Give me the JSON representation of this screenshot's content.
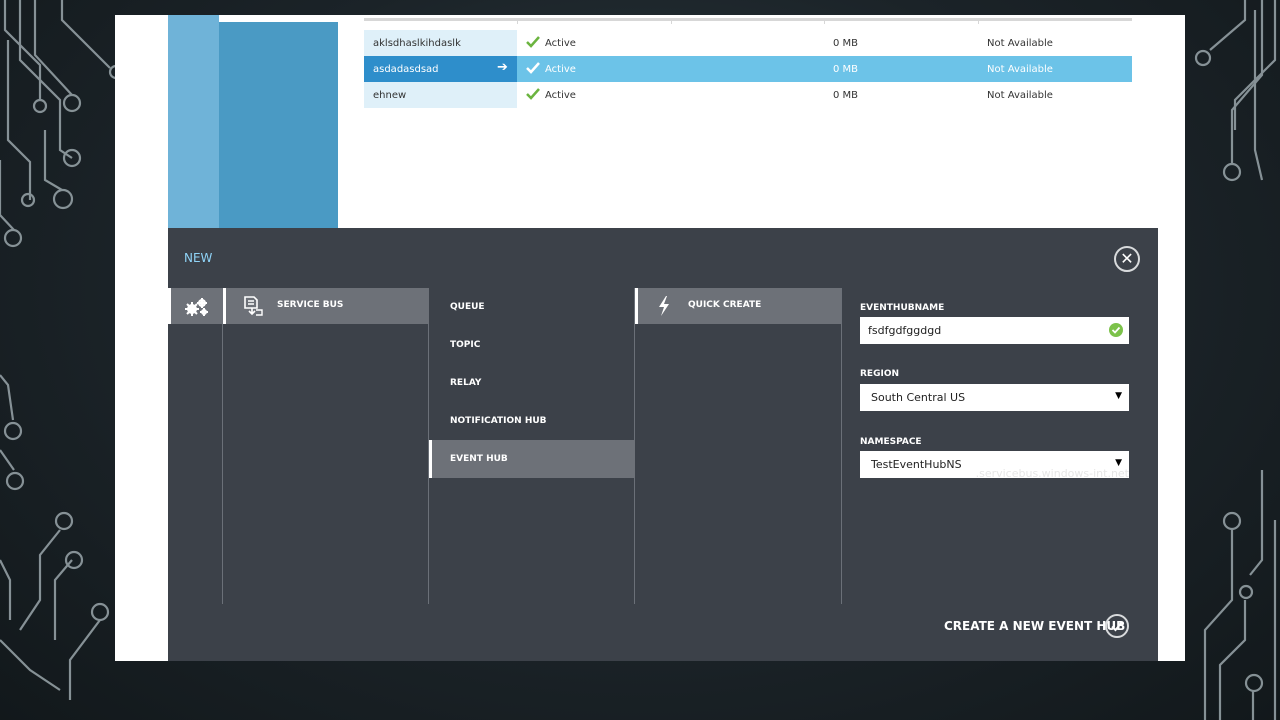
{
  "table": {
    "rows": [
      {
        "name": "aklsdhaslkihdaslk",
        "status": "Active",
        "size": "0 MB",
        "availability": "Not Available",
        "selected": false
      },
      {
        "name": "asdadasdsad",
        "status": "Active",
        "size": "0 MB",
        "availability": "Not Available",
        "selected": true
      },
      {
        "name": "ehnew",
        "status": "Active",
        "size": "0 MB",
        "availability": "Not Available",
        "selected": false
      }
    ]
  },
  "panel": {
    "title": "NEW",
    "service_bus_label": "SERVICE BUS",
    "menu": [
      "QUEUE",
      "TOPIC",
      "RELAY",
      "NOTIFICATION HUB",
      "EVENT HUB"
    ],
    "active_menu": "EVENT HUB",
    "quick_create_label": "QUICK CREATE",
    "form": {
      "name_label": "EVENTHUBNAME",
      "name_value": "fsdfgdfggdgd",
      "region_label": "REGION",
      "region_value": "South Central US",
      "namespace_label": "NAMESPACE",
      "namespace_value": "TestEventHubNS",
      "namespace_suffix": ".servicebus.windows-int.net"
    },
    "create_label": "CREATE A NEW EVENT HUB"
  },
  "colors": {
    "accent": "#2e8ecb",
    "selected_row": "#6cc3e8",
    "panel_bg": "#3c4149",
    "success": "#7cc24a"
  }
}
